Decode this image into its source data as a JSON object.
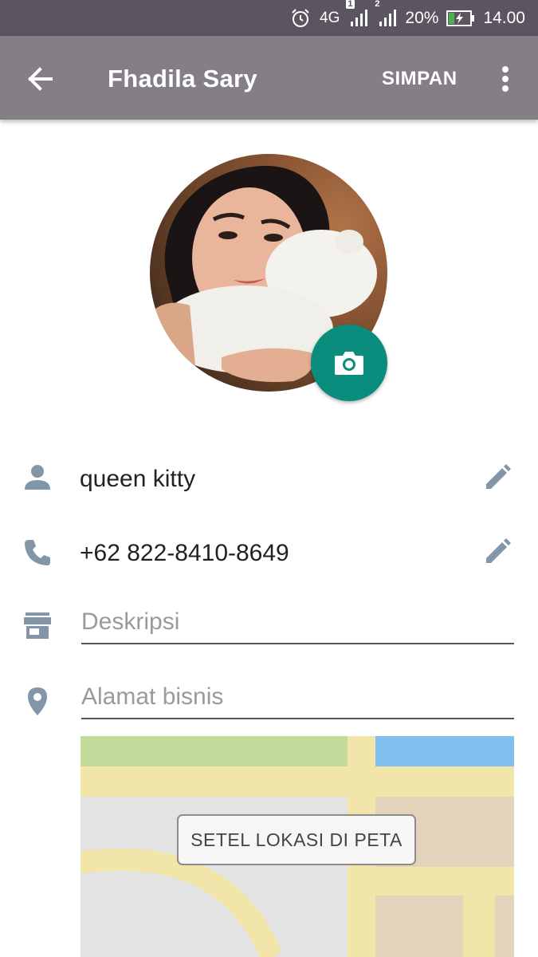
{
  "status_bar": {
    "network": "4G",
    "sim1_badge": "1",
    "sim2_badge": "2",
    "battery_percent": "20%",
    "time": "14.00",
    "icons": [
      "alarm-icon",
      "signal-sim1-icon",
      "signal-sim2-icon",
      "battery-charging-icon"
    ]
  },
  "app_bar": {
    "title": "Fhadila Sary",
    "save_label": "SIMPAN",
    "icons": [
      "back-arrow-icon",
      "more-vert-icon"
    ]
  },
  "profile": {
    "name": "queen kitty",
    "phone": "+62 822-8410-8649",
    "description_placeholder": "Deskripsi",
    "description_value": "",
    "address_placeholder": "Alamat bisnis",
    "address_value": "",
    "icons": [
      "person-icon",
      "phone-icon",
      "store-icon",
      "location-pin-icon",
      "edit-pencil-icon",
      "camera-icon"
    ]
  },
  "map": {
    "set_location_label": "SETEL LOKASI DI PETA"
  },
  "colors": {
    "status_bar": "#5a5560",
    "app_bar": "#847e87",
    "accent": "#0a8d7c",
    "icon": "#8296a8",
    "map_road": "#f2e5a9",
    "map_green": "#c2da9a",
    "map_water": "#81bfee"
  }
}
